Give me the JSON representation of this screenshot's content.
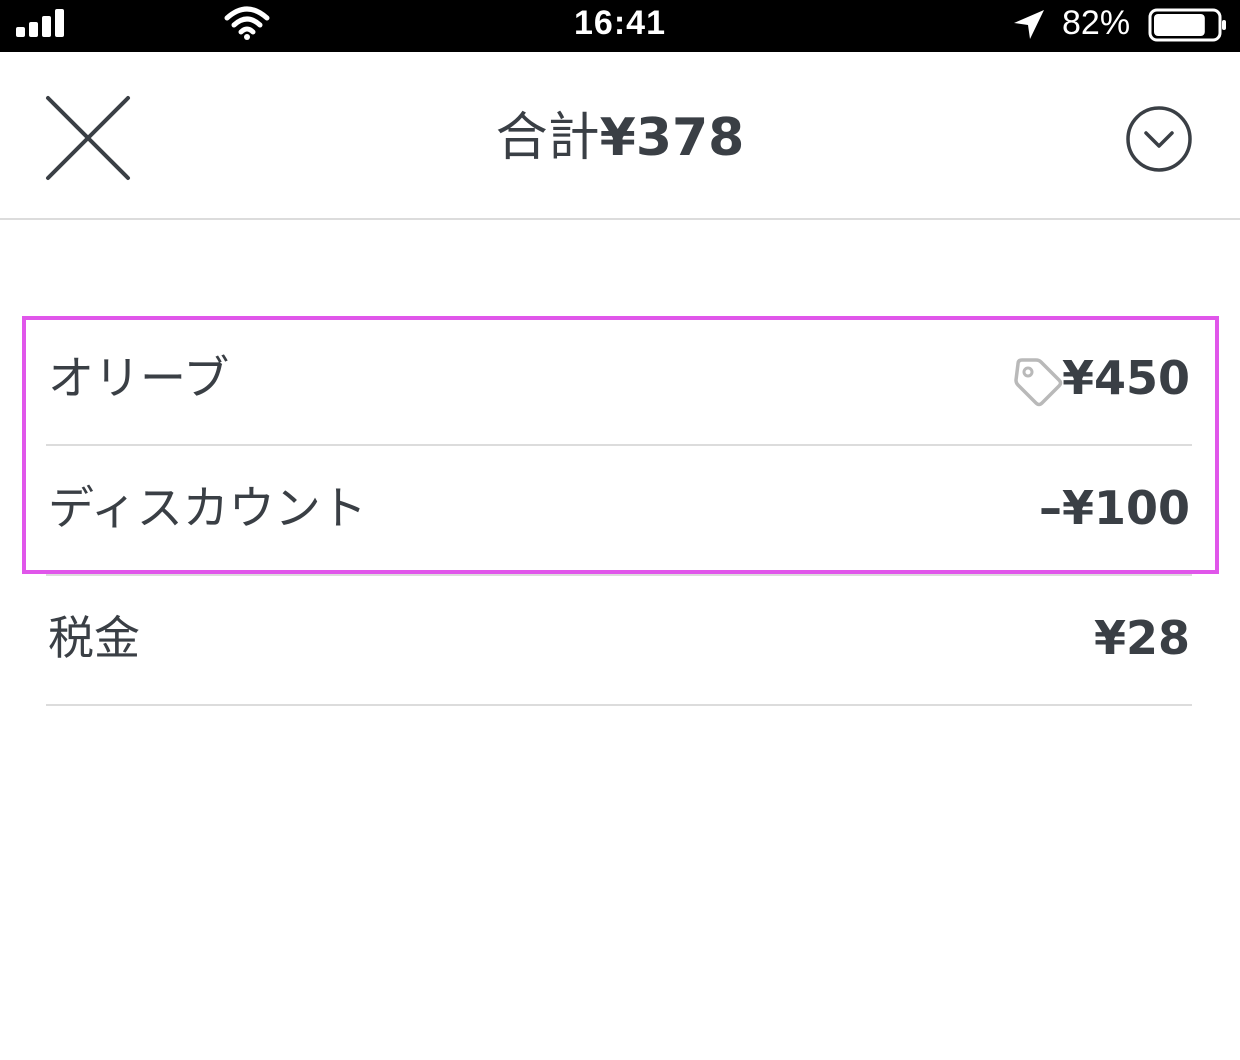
{
  "status_bar": {
    "time": "16:41",
    "battery_percent": "82%",
    "battery_level": 0.82,
    "icons": [
      "signal-icon",
      "wifi-icon",
      "location-arrow-icon",
      "battery-icon"
    ]
  },
  "header": {
    "title_prefix": "合計",
    "title_amount": "¥378",
    "close_icon": "close-icon",
    "collapse_icon": "chevron-down-circle-icon"
  },
  "items": [
    {
      "label": "オリーブ",
      "value": "¥450",
      "icon": "tag-icon"
    },
    {
      "label": "ディスカウント",
      "value": "–¥100"
    },
    {
      "label": "税金",
      "value": "¥28"
    }
  ],
  "colors": {
    "text": "#3a3f45",
    "divider": "#dcdcdc",
    "highlight": "#e056ea",
    "tag_icon": "#b9b9b9"
  }
}
